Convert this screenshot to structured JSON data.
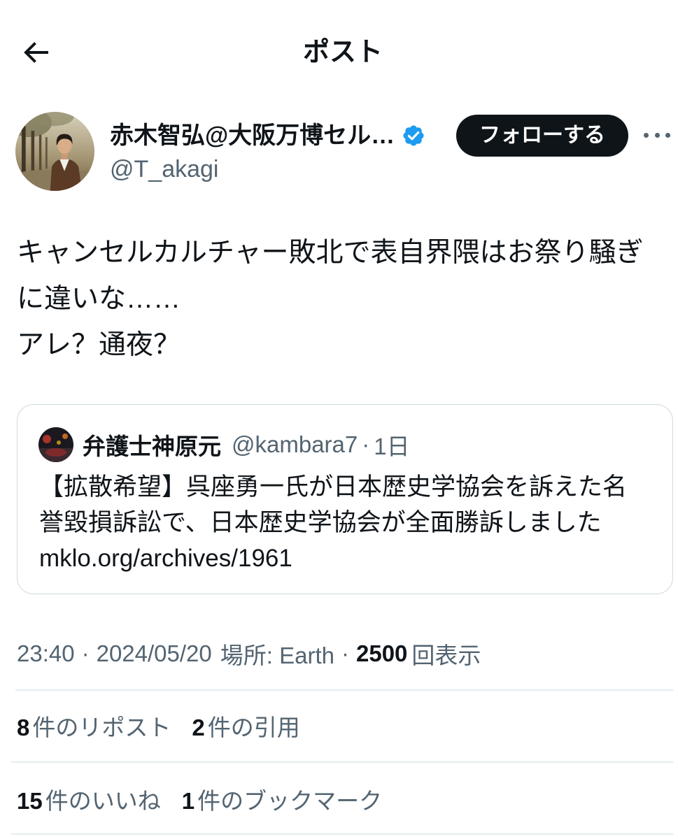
{
  "header": {
    "title": "ポスト",
    "back_icon": "arrow-left-icon"
  },
  "author": {
    "display_name": "赤木智弘@大阪万博セル…",
    "handle": "@T_akagi",
    "verified_icon": "verified-badge-icon",
    "follow_label": "フォローする",
    "more_icon": "more-horizontal-icon"
  },
  "post": {
    "lines": [
      "キャンセルカルチャー敗北で表自界隈はお祭り騒ぎ",
      "に違いな……",
      "アレ？通夜？"
    ]
  },
  "quote": {
    "display_name": "弁護士神原元",
    "handle": "@kambara7",
    "separator": "·",
    "age": "1日",
    "lines": [
      "【拡散希望】呉座勇一氏が日本歴史学協会を訴えた名",
      "誉毀損訴訟で、日本歴史学協会が全面勝訴しました",
      "mklo.org/archives/1961"
    ]
  },
  "meta": {
    "time": "23:40",
    "separator": "·",
    "date": "2024/05/20",
    "location": "場所: Earth",
    "views_count": "2500",
    "views_label": "回表示"
  },
  "stats": {
    "reposts": {
      "count": "8",
      "label": "件のリポスト"
    },
    "quotes": {
      "count": "2",
      "label": "件の引用"
    },
    "likes": {
      "count": "15",
      "label": "件のいいね"
    },
    "bookmarks": {
      "count": "1",
      "label": "件のブックマーク"
    }
  },
  "colors": {
    "text_primary": "#0f1419",
    "text_secondary": "#536471",
    "border": "#cfd9de",
    "divider": "#e6ecf0",
    "verified": "#1d9bf0",
    "follow_bg": "#0f1419"
  }
}
